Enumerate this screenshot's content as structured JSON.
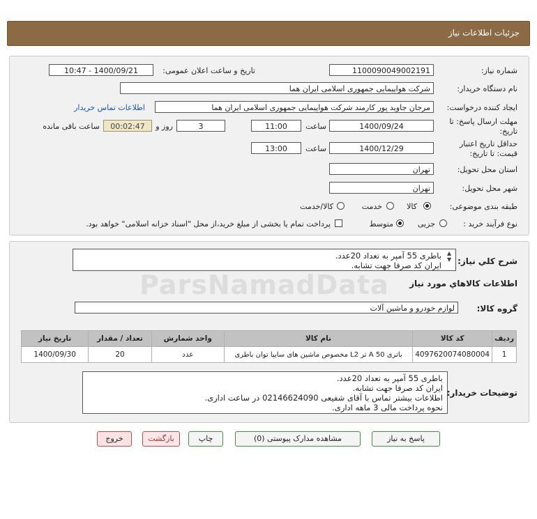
{
  "title": "جزئیات اطلاعات نیاز",
  "fields": {
    "need_number_label": "شماره نیاز:",
    "need_number": "1100090049002191",
    "announce_label": "تاریخ و ساعت اعلان عمومی:",
    "announce_value": "1400/09/21 - 10:47",
    "buyer_org_label": "نام دستگاه خریدار:",
    "buyer_org": "شرکت هواپیمایی جمهوری اسلامی ایران هما",
    "creator_label": "ایجاد کننده درخواست:",
    "creator": "مرجان جاوید پور کارمند شرکت هواپیمایی جمهوری اسلامی ایران هما",
    "contact_link": "اطلاعات تماس خریدار",
    "deadline_label_1": "مهلت ارسال پاسخ: تا",
    "deadline_label_2": "تاریخ:",
    "deadline_date": "1400/09/24",
    "time_word": "ساعت",
    "deadline_time": "11:00",
    "days_value": "3",
    "days_word": "روز و",
    "remaining_value": "00:02:47",
    "remaining_word": "ساعت باقی مانده",
    "validity_label_1": "حداقل تاریخ اعتبار",
    "validity_label_2": "قیمت: تا تاریخ:",
    "validity_date": "1400/12/29",
    "validity_time": "13:00",
    "province_label": "استان محل تحویل:",
    "province": "تهران",
    "city_label": "شهر محل تحویل:",
    "city": "تهران",
    "category_label": "طبقه بندی موضوعی:",
    "category_options": [
      "کالا",
      "خدمت",
      "کالا/خدمت"
    ],
    "category_selected": "کالا",
    "process_label": "نوع فرآیند خرید :",
    "process_options": [
      "جزیی",
      "متوسط"
    ],
    "process_selected": "متوسط",
    "payment_note": "پرداخت تمام یا بخشی از مبلغ خرید،از محل \"اسناد خزانه اسلامی\" خواهد بود."
  },
  "summary": {
    "label": "شرح کلي نياز:",
    "text": "باطری 55 آمپر به تعداد 20عدد.\nایران کد صرفا جهت تشابه."
  },
  "goods_section_title": "اطلاعات کالاهاي مورد نياز",
  "goods_group": {
    "label": "گروه کالا:",
    "value": "لوازم خودرو و ماشین آلات"
  },
  "table": {
    "headers": [
      "ردیف",
      "کد کالا",
      "نام کالا",
      "واحد شمارش",
      "تعداد / مقدار",
      "تاریخ نیاز"
    ],
    "rows": [
      [
        "1",
        "4097620074080004",
        "باتری 50 A تر L2 مخصوص ماشین های سایپا توان باطری",
        "عدد",
        "20",
        "1400/09/30"
      ]
    ]
  },
  "buyer_notes": {
    "label": "توضیحات خریدار:",
    "text": "باطری 55 آمپر به تعداد 20عدد.\nایران کد صرفا جهت تشابه.\nاطلاعات بیشتر تماس با آقای شفیعی 02146624090 در ساعت اداری.\nنحوه پرداخت مالی 3 ماهه اداری."
  },
  "buttons": {
    "reply": "پاسخ به نیاز",
    "attachments": "مشاهده مدارک پیوستی (0)",
    "print": "چاپ",
    "back": "بازگشت",
    "exit": "خروج"
  },
  "colors": {
    "title_bar": "#8b6a45",
    "panel": "#f1f1f1",
    "table_header": "#c2c2c2",
    "link": "#1a55b0",
    "remaining_bg": "#efe6c8"
  }
}
